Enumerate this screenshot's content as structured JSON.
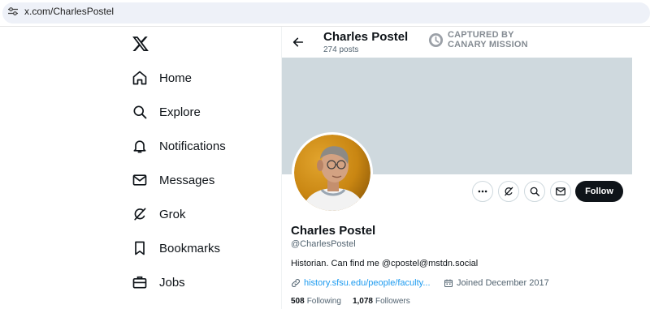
{
  "browser": {
    "url": "x.com/CharlesPostel"
  },
  "nav": {
    "items": [
      {
        "label": "Home",
        "icon": "home-icon"
      },
      {
        "label": "Explore",
        "icon": "search-icon"
      },
      {
        "label": "Notifications",
        "icon": "bell-icon"
      },
      {
        "label": "Messages",
        "icon": "envelope-icon"
      },
      {
        "label": "Grok",
        "icon": "grok-icon"
      },
      {
        "label": "Bookmarks",
        "icon": "bookmark-icon"
      },
      {
        "label": "Jobs",
        "icon": "briefcase-icon"
      }
    ]
  },
  "header": {
    "name": "Charles Postel",
    "posts": "274 posts"
  },
  "watermark": {
    "line1": "CAPTURED BY",
    "line2": "CANARY MISSION"
  },
  "profile": {
    "name": "Charles Postel",
    "handle": "@CharlesPostel",
    "bio": "Historian. Can find me @cpostel@mstdn.social",
    "link": "history.sfsu.edu/people/faculty...",
    "joined": "Joined December 2017",
    "following_count": "508",
    "following_label": "Following",
    "followers_count": "1,078",
    "followers_label": "Followers",
    "follow_label": "Follow"
  },
  "colors": {
    "banner": "#cfd9de",
    "link": "#1d9bf0",
    "follow_bg": "#0f1419"
  }
}
